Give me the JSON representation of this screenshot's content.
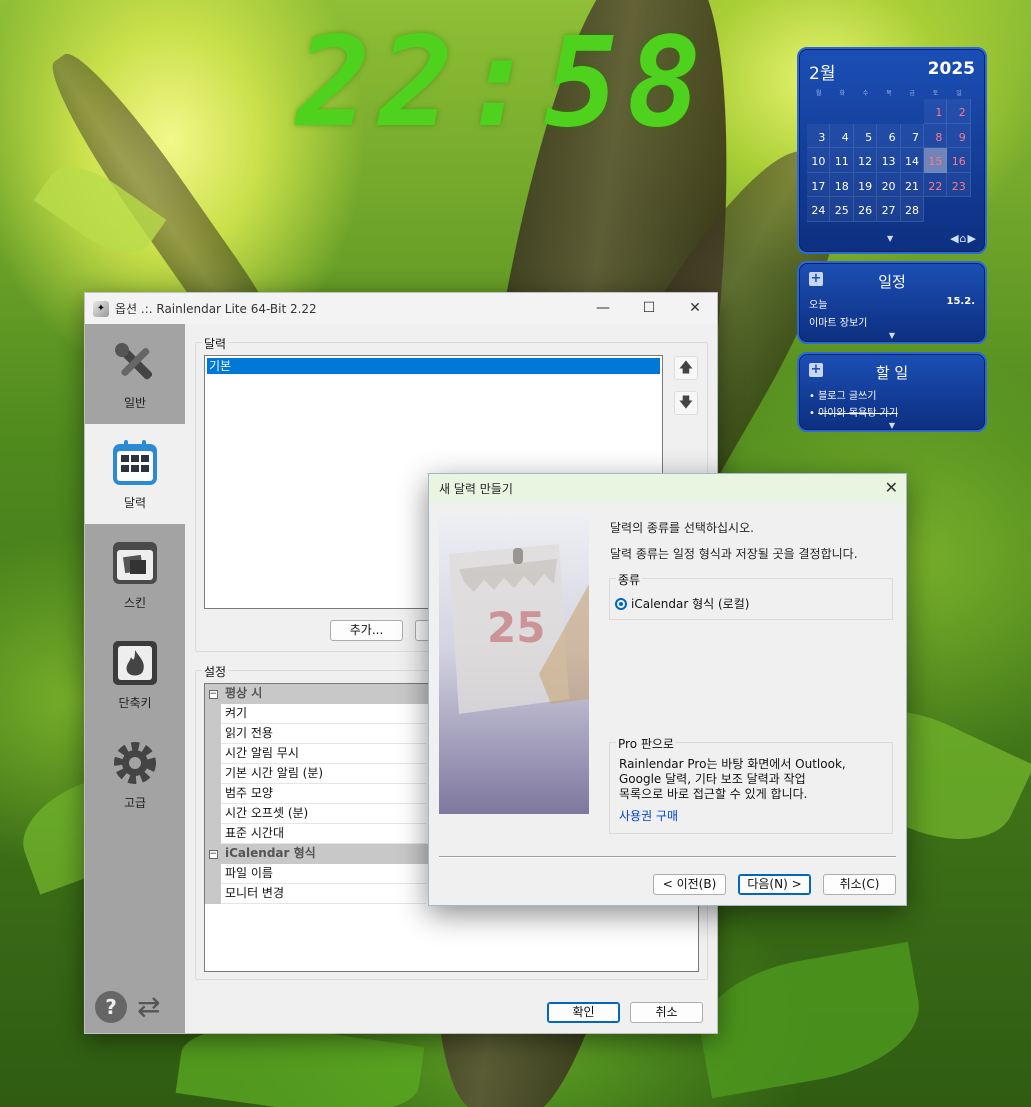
{
  "clock": {
    "time": "22:58"
  },
  "calendar_widget": {
    "month": "2월",
    "year": "2025",
    "weekdays": [
      "월",
      "화",
      "수",
      "목",
      "금",
      "토",
      "일"
    ],
    "weeks": [
      [
        "",
        "",
        "",
        "",
        "",
        "1",
        "2"
      ],
      [
        "3",
        "4",
        "5",
        "6",
        "7",
        "8",
        "9"
      ],
      [
        "10",
        "11",
        "12",
        "13",
        "14",
        "15",
        "16"
      ],
      [
        "17",
        "18",
        "19",
        "20",
        "21",
        "22",
        "23"
      ],
      [
        "24",
        "25",
        "26",
        "27",
        "28",
        "",
        ""
      ]
    ],
    "today": "15"
  },
  "events_widget": {
    "title": "일정",
    "day_label": "오늘",
    "date": "15.2.",
    "event": "이마트 장보기"
  },
  "todo_widget": {
    "title": "할 일",
    "items": [
      {
        "text": "블로그 글쓰기",
        "done": false
      },
      {
        "text": "아이와 목욕탕 가기",
        "done": true
      }
    ]
  },
  "options_window": {
    "title": "옵션 .:. Rainlendar Lite 64-Bit 2.22",
    "sidebar": [
      {
        "label": "일반",
        "icon": "tools-icon"
      },
      {
        "label": "달력",
        "icon": "calendar-icon"
      },
      {
        "label": "스킨",
        "icon": "skin-icon"
      },
      {
        "label": "단축키",
        "icon": "hotkey-icon"
      },
      {
        "label": "고급",
        "icon": "gear-icon"
      }
    ],
    "calendars_group": "달력",
    "calendar_list": [
      "기본"
    ],
    "add_button": "추가...",
    "settings_group": "설정",
    "properties": [
      {
        "name": "평상 시",
        "category": true
      },
      {
        "name": "켜기"
      },
      {
        "name": "읽기 전용"
      },
      {
        "name": "시간 알림 무시"
      },
      {
        "name": "기본 시간 알림 (분)"
      },
      {
        "name": "범주 모양"
      },
      {
        "name": "시간 오프셋 (분)"
      },
      {
        "name": "표준 시간대"
      },
      {
        "name": "iCalendar 형식",
        "category": true
      },
      {
        "name": "파일 이름"
      },
      {
        "name": "모니터 변경"
      }
    ],
    "ok_button": "확인",
    "cancel_button": "취소"
  },
  "wizard": {
    "title": "새 달력 만들기",
    "heading": "달력의 종류를 선택하십시오.",
    "description": "달력 종류는 일정 형식과 저장될 곳을 결정합니다.",
    "type_group": "종류",
    "type_option": "iCalendar 형식 (로컬)",
    "pro_group": "Pro 판으로",
    "pro_text": [
      "Rainlendar Pro는 바탕 화면에서 Outlook,",
      "Google 달력, 기타 보조 달력과 작업",
      "목록으로 바로 접근할 수 있게 합니다."
    ],
    "buy_link": "사용권 구매",
    "back_button": "< 이전(B)",
    "next_button": "다음(N) >",
    "cancel_button": "취소(C)",
    "art_day": "25"
  },
  "colors": {
    "clock": "#4ed21e",
    "widget_blue": "#1b4fb5",
    "weekend": "#ff7a86",
    "selection": "#0078d7",
    "link": "#0044cc"
  }
}
